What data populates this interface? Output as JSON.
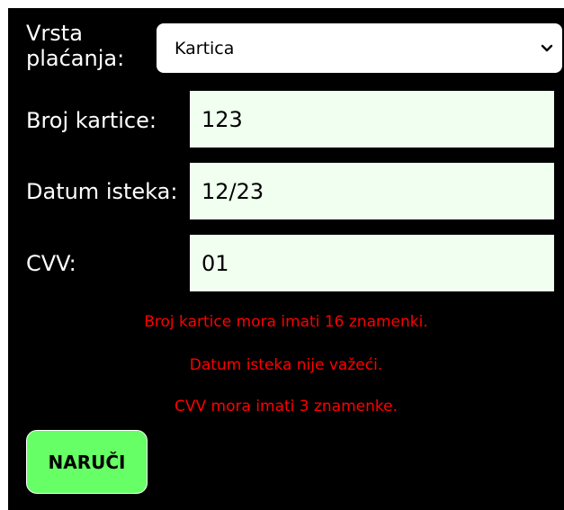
{
  "form": {
    "payment_type_label": "Vrsta plaćanja:",
    "payment_type_value": "Kartica",
    "card_number_label": "Broj kartice:",
    "card_number_value": "123",
    "expiry_label": "Datum isteka:",
    "expiry_value": "12/23",
    "cvv_label": "CVV:",
    "cvv_value": "01"
  },
  "errors": [
    "Broj kartice mora imati 16 znamenki.",
    "Datum isteka nije važeći.",
    "CVV mora imati 3 znamenke."
  ],
  "order_button_label": "NARUČI",
  "icons": {
    "select_arrow": "chevron-down-icon"
  },
  "colors": {
    "background": "#000000",
    "field_background": "#f0fff0",
    "error_text": "#ff0000",
    "button_background": "#66ff66"
  }
}
